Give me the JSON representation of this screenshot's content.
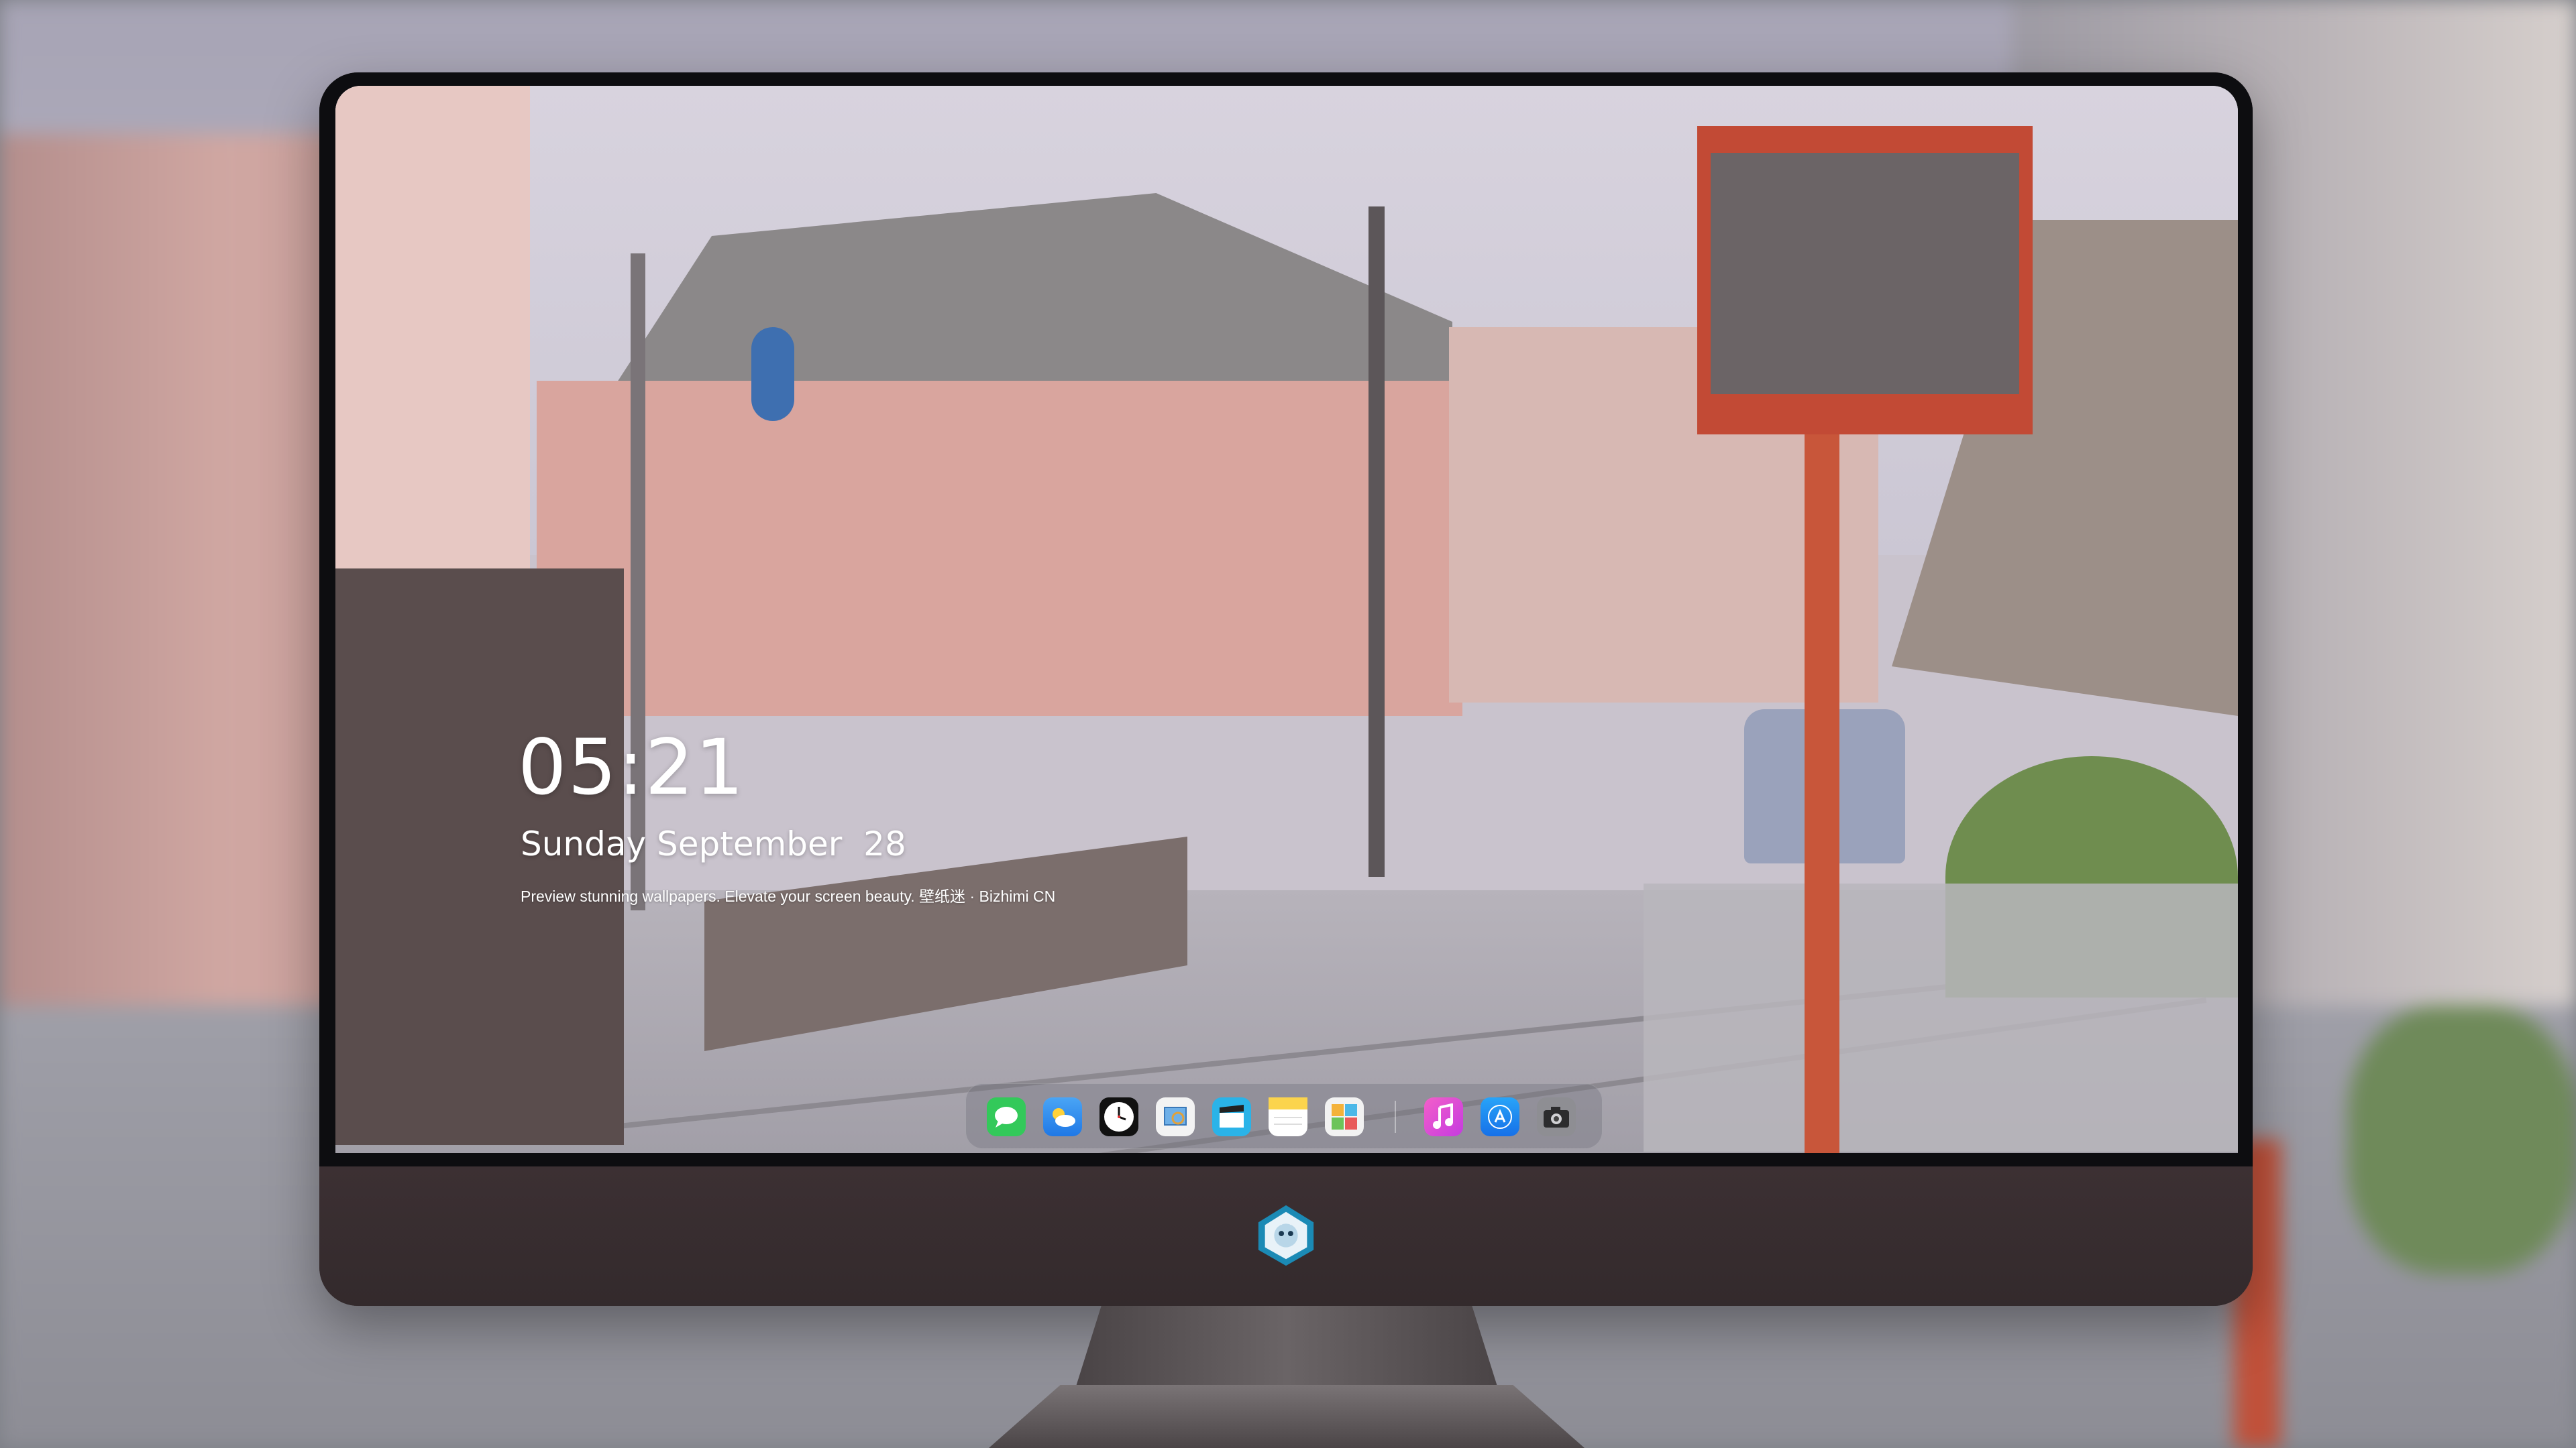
{
  "lock_screen": {
    "time": "05:21",
    "date": "Sunday September  28",
    "tagline": "Preview stunning wallpapers. Elevate your screen beauty. 壁纸迷 · Bizhimi CN"
  },
  "dock": {
    "apps": [
      {
        "icon": "messages-icon",
        "color": "#33c95a"
      },
      {
        "icon": "weather-icon",
        "color": "#2f8ff0"
      },
      {
        "icon": "clock-icon",
        "color": "#111111"
      },
      {
        "icon": "preview-icon",
        "color": "#f3f3f3"
      },
      {
        "icon": "clips-icon",
        "color": "#2ab3e8"
      },
      {
        "icon": "notes-icon",
        "color": "#fbd44d"
      },
      {
        "icon": "photos-icon",
        "color": "#f2f2f2"
      },
      {
        "icon": "music-icon",
        "color": "#e845b8"
      },
      {
        "icon": "app-store-icon",
        "color": "#1e8cf5"
      },
      {
        "icon": "camera-icon",
        "color": "#8e8e93"
      }
    ]
  }
}
